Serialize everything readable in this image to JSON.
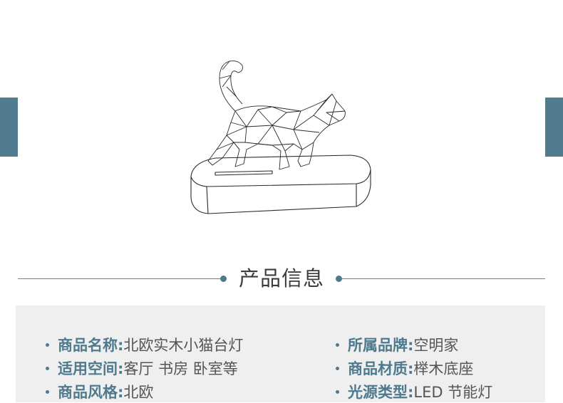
{
  "colors": {
    "accent": "#517c90",
    "label_text": "#4f7a8e",
    "value_text": "#555555",
    "panel_background": "#efefef"
  },
  "section": {
    "title": "产品信息"
  },
  "product_info": {
    "left_column": [
      {
        "label": "商品名称:",
        "value": "北欧实木小猫台灯"
      },
      {
        "label": "适用空间:",
        "value": "客厅 书房 卧室等"
      },
      {
        "label": "商品风格:",
        "value": "北欧"
      }
    ],
    "right_column": [
      {
        "label": "所属品牌:",
        "value": "空明家"
      },
      {
        "label": "商品材质:",
        "value": "榉木底座"
      },
      {
        "label": "光源类型:",
        "value": "LED 节能灯"
      }
    ]
  }
}
